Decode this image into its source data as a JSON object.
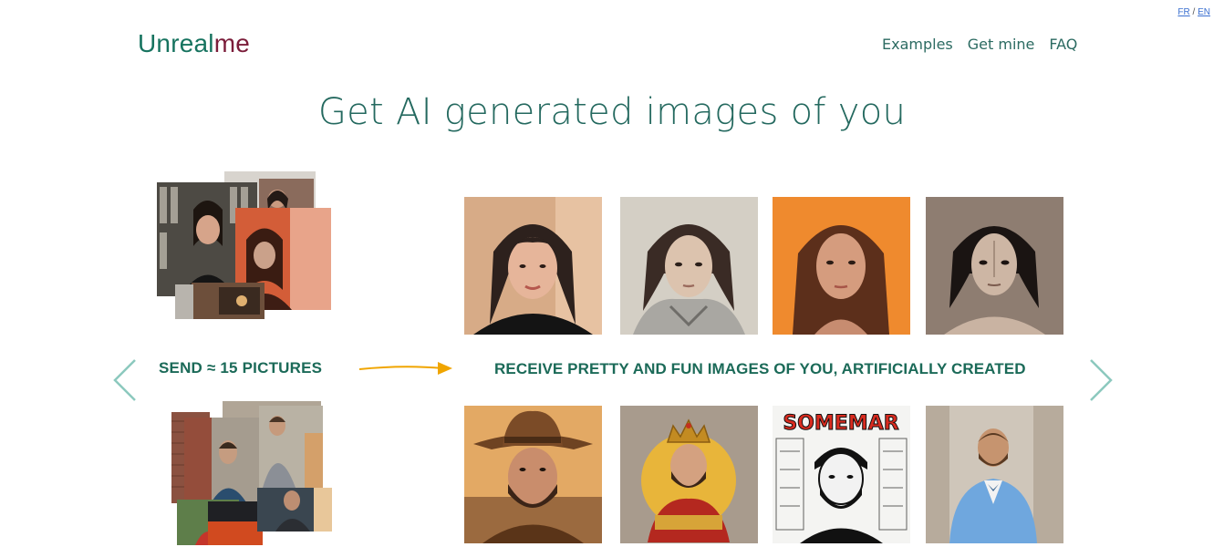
{
  "lang": {
    "fr": "FR",
    "sep": "/",
    "en": "EN"
  },
  "logo": {
    "part1": "Unreal",
    "part2": "me"
  },
  "nav": [
    "Examples",
    "Get mine",
    "FAQ"
  ],
  "headline": "Get AI generated images of you",
  "send_label": "SEND ≈ 15 PICTURES",
  "receive_label": "RECEIVE PRETTY AND FUN IMAGES OF YOU, ARTIFICIALLY CREATED",
  "portraits_top": [
    {
      "name": "woman-realistic-portrait",
      "bg": "#d9b08d"
    },
    {
      "name": "woman-armor-portrait",
      "bg": "#c9c3ba"
    },
    {
      "name": "woman-orange-portrait",
      "bg": "#ef8a2e"
    },
    {
      "name": "woman-sketch-portrait",
      "bg": "#8c7a6e"
    }
  ],
  "portraits_bottom": [
    {
      "name": "man-cowboy-portrait",
      "bg": "#d99b55"
    },
    {
      "name": "man-king-portrait",
      "bg": "#e8b53a"
    },
    {
      "name": "man-comic-portrait",
      "bg": "#f2f2f2",
      "comic_title": "SOMEMAR"
    },
    {
      "name": "man-suit-portrait",
      "bg": "#c9c0b4"
    }
  ],
  "colors": {
    "accent": "#1b6a58",
    "arrow": "#f0a500",
    "chevron": "#8cc9be",
    "logo_secondary": "#7b1d3a"
  }
}
